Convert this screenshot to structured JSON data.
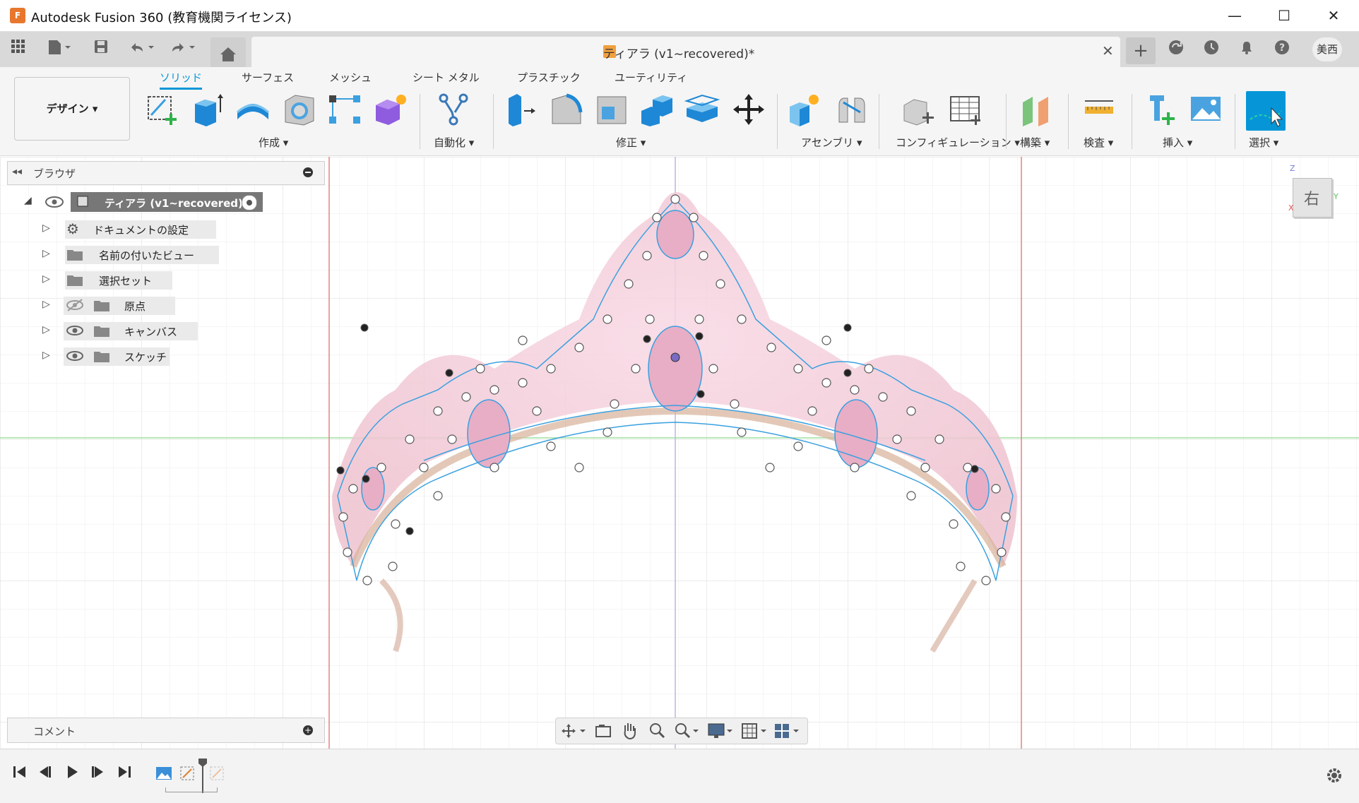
{
  "window": {
    "logo_text": "F",
    "title": "Autodesk Fusion 360 (教育機関ライセンス)",
    "minimize": "—",
    "maximize": "☐",
    "close": "✕"
  },
  "tabbar": {
    "doc_title": "ティアラ (v1~recovered)*",
    "doc_close": "✕",
    "new_tab": "+",
    "user_initials": "美西"
  },
  "ribbon": {
    "workspace": "デザイン ▾",
    "tabs": [
      "ソリッド",
      "サーフェス",
      "メッシュ",
      "シート メタル",
      "プラスチック",
      "ユーティリティ"
    ],
    "active_tab": "ソリッド",
    "groups": [
      "作成 ▾",
      "自動化 ▾",
      "修正 ▾",
      "アセンブリ ▾",
      "コンフィギュレーション ▾",
      "構築 ▾",
      "検査 ▾",
      "挿入 ▾",
      "選択 ▾"
    ]
  },
  "browser": {
    "title": "ブラウザ",
    "root": "ティアラ (v1~recovered)",
    "items": [
      {
        "label": "ドキュメントの設定",
        "icon": "gear-icon"
      },
      {
        "label": "名前の付いたビュー",
        "icon": "folder-icon"
      },
      {
        "label": "選択セット",
        "icon": "folder-icon"
      },
      {
        "label": "原点",
        "icon": "folder-icon",
        "visibility": "hidden"
      },
      {
        "label": "キャンバス",
        "icon": "folder-icon",
        "visibility": "visible"
      },
      {
        "label": "スケッチ",
        "icon": "folder-icon",
        "visibility": "visible"
      }
    ]
  },
  "comments": {
    "title": "コメント"
  },
  "viewcube": {
    "face": "右",
    "axis_z": "Z",
    "axis_y": "Y",
    "axis_x": "X"
  },
  "colors": {
    "accent": "#0696d7",
    "select_button": "#0696d7",
    "grid_line": "#e6e6e6",
    "axis_red": "#e05050",
    "axis_green": "#7fd07f",
    "axis_blue": "#9b9bd8",
    "sketch_line": "#3aa0e0"
  }
}
